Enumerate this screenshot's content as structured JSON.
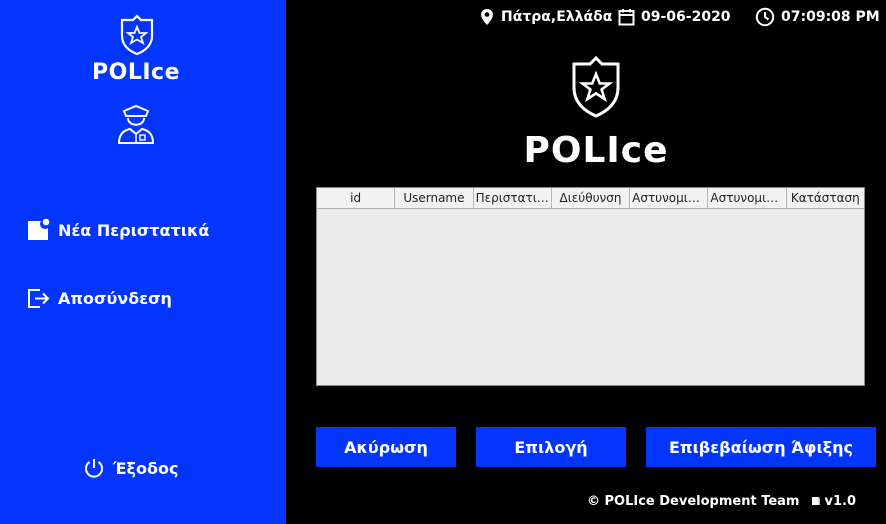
{
  "sidebar": {
    "brand": "POLIce",
    "items": [
      {
        "label": "Νέα Περιστατικά",
        "icon": "new-incident-icon"
      },
      {
        "label": "Αποσύνδεση",
        "icon": "logout-icon"
      }
    ],
    "exit_label": "Έξοδος"
  },
  "topbar": {
    "location": "Πάτρα,Ελλάδα",
    "date": "09-06-2020",
    "time": "07:09:08 PM"
  },
  "main": {
    "brand": "POLIce"
  },
  "table": {
    "columns": [
      "id",
      "Username",
      "Περιστατικό",
      "Διεύθυνση",
      "Αστυνομικός",
      "Αστυνομική ...",
      "Κατάσταση"
    ],
    "rows": []
  },
  "buttons": {
    "cancel": "Ακύρωση",
    "select": "Επιλογή",
    "confirm": "Επιβεβαίωση Άφιξης"
  },
  "footer": {
    "credits": "© POLIce Development Team",
    "version": "v1.0"
  },
  "colors": {
    "accent": "#0335FC",
    "background": "#000000"
  }
}
